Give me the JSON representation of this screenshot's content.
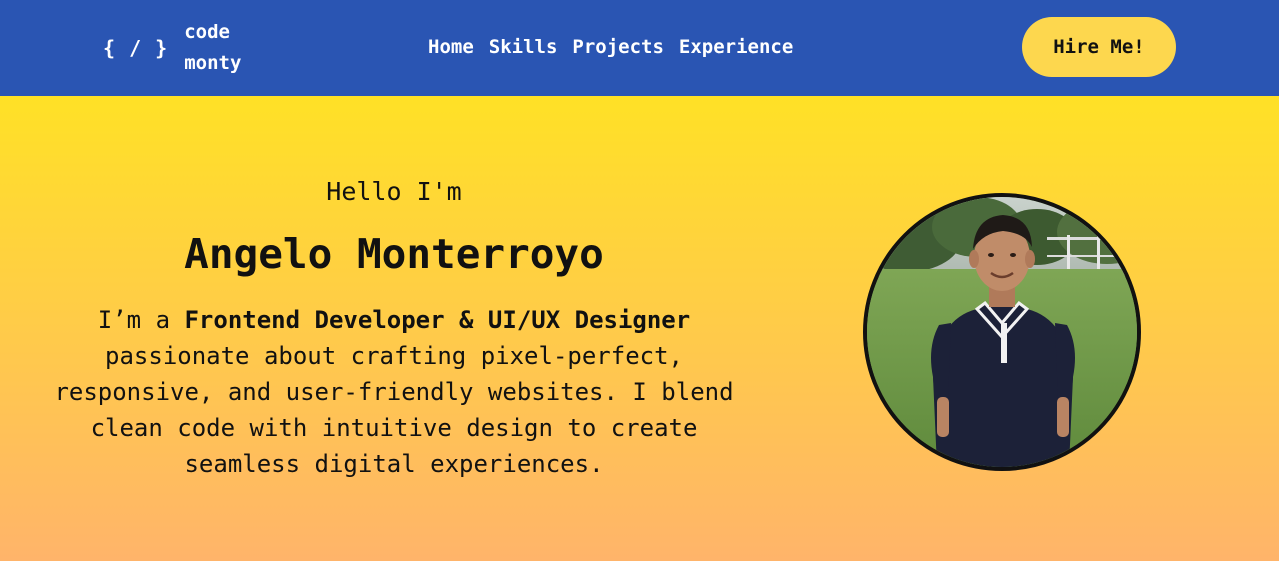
{
  "logo": {
    "mark": "{ / }",
    "line1": "code",
    "line2": "monty"
  },
  "nav": {
    "items": [
      {
        "label": "Home"
      },
      {
        "label": "Skills"
      },
      {
        "label": "Projects"
      },
      {
        "label": "Experience"
      }
    ],
    "hire_label": "Hire Me!"
  },
  "hero": {
    "greeting": "Hello I'm",
    "name": "Angelo Monterroyo",
    "bio_prefix": "I’m a ",
    "bio_role": "Frontend Developer & UI/UX Designer",
    "bio_rest": " passionate about crafting pixel-perfect, responsive, and user-friendly websites. I blend clean code with intuitive design to create seamless digital experiences."
  },
  "colors": {
    "navbar": "#2a55b3",
    "accent_button": "#fdd74e",
    "hero_gradient_top": "#ffe126",
    "hero_gradient_bottom": "#ffb46a",
    "text": "#111111"
  }
}
